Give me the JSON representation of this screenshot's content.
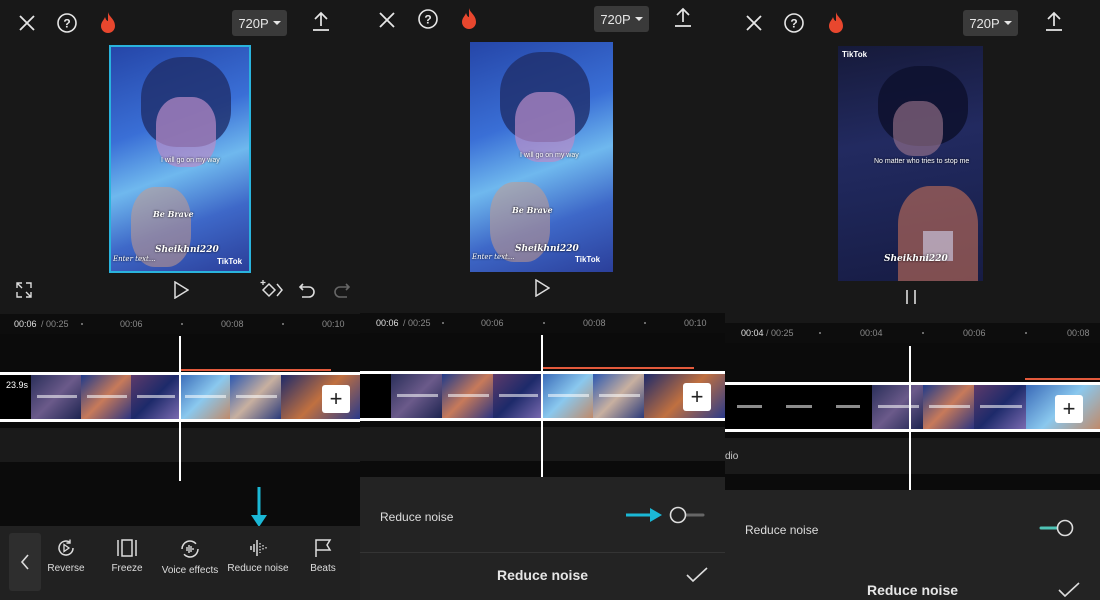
{
  "colors": {
    "accent_cyan": "#1bb8d6",
    "flame": "#e8472e",
    "toggle_on": "#4fc3b5",
    "timeline_red": "#e45a3c"
  },
  "panels": [
    {
      "top": {
        "close": "close-icon",
        "help": "help-icon",
        "flame": "flame-icon",
        "resolution": "720P",
        "export": "export-icon"
      },
      "preview": {
        "caption1": "I will go on my way",
        "caption2": "Be Brave",
        "watermark": "Sheikhni220",
        "enter_text": "Enter text...",
        "tiktok": "TikTok"
      },
      "controls": {
        "fullscreen": "fullscreen-icon",
        "play": "play-icon",
        "keyframe": "keyframe-icon",
        "undo": "undo-icon",
        "redo": "redo-icon"
      },
      "ruler": {
        "current": "00:06",
        "total": "/ 00:25",
        "ticks": [
          "00:06",
          "00:08",
          "00:10"
        ]
      },
      "clip": {
        "duration": "23.9s"
      },
      "toolbar": {
        "items": [
          {
            "label": "Reverse",
            "icon": "reverse-icon"
          },
          {
            "label": "Freeze",
            "icon": "freeze-icon"
          },
          {
            "label": "Voice effects",
            "icon": "voice-effects-icon"
          },
          {
            "label": "Reduce noise",
            "icon": "reduce-noise-icon"
          },
          {
            "label": "Beats",
            "icon": "beats-icon"
          }
        ]
      }
    },
    {
      "top": {
        "resolution": "720P"
      },
      "preview": {
        "caption1": "I will go on my way",
        "caption2": "Be Brave",
        "watermark": "Sheikhni220",
        "enter_text": "Enter text...",
        "tiktok": "TikTok"
      },
      "ruler": {
        "current": "00:06",
        "total": "/ 00:25",
        "ticks": [
          "00:06",
          "00:08",
          "00:10"
        ]
      },
      "sheet": {
        "option_label": "Reduce noise",
        "toggle_on": false,
        "title": "Reduce noise"
      }
    },
    {
      "top": {
        "resolution": "720P"
      },
      "preview": {
        "caption1": "No matter who tries to stop me",
        "watermark": "Sheikhni220",
        "tiktok": "TikTok"
      },
      "ruler": {
        "current": "00:04",
        "total": "/ 00:25",
        "ticks": [
          "00:04",
          "00:06",
          "00:08"
        ]
      },
      "audio_label": "dio",
      "sheet": {
        "option_label": "Reduce noise",
        "toggle_on": true,
        "title": "Reduce noise"
      }
    }
  ]
}
